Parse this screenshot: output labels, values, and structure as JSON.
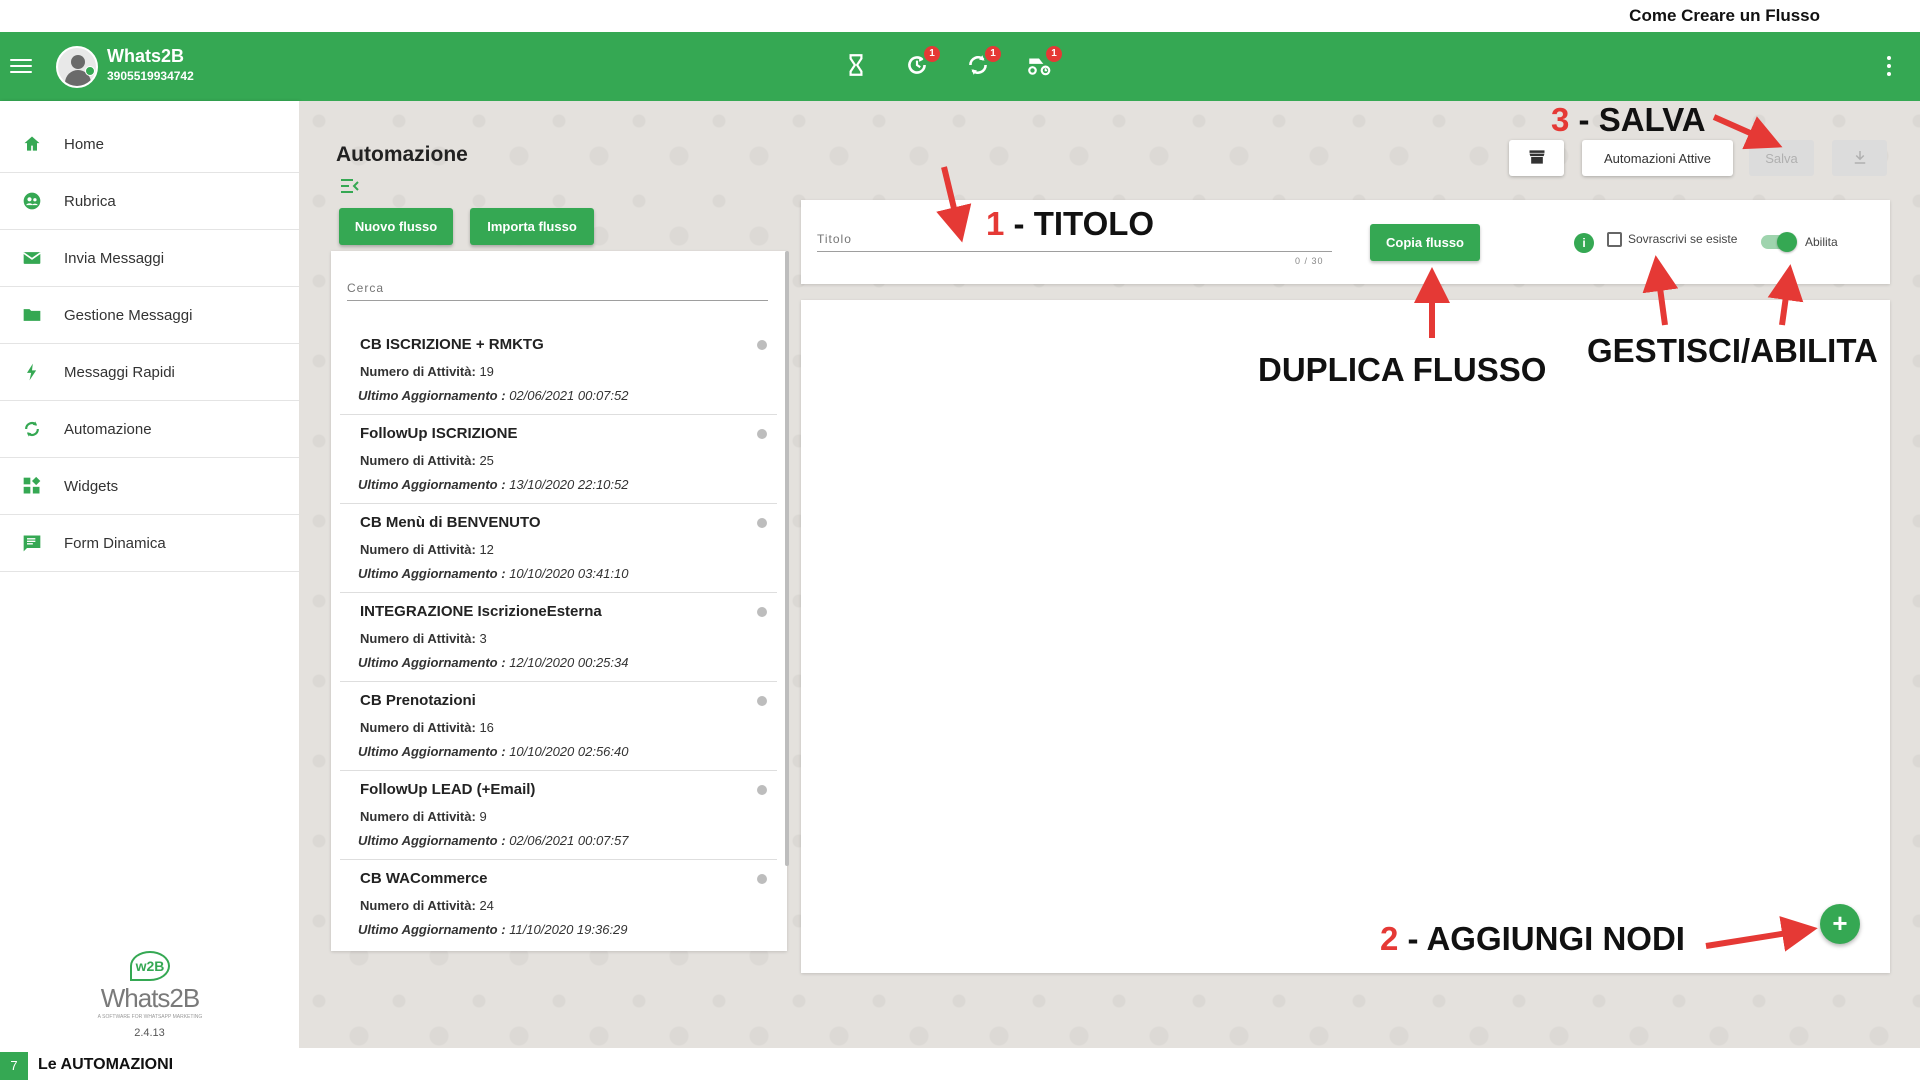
{
  "caption": {
    "top": "Come Creare un Flusso",
    "page_number": "7",
    "bottom": "Le AUTOMAZIONI"
  },
  "header": {
    "app_name": "Whats2B",
    "phone": "3905519934742",
    "badges": {
      "history": "1",
      "sync": "1",
      "moto": "1"
    },
    "icons": [
      "hourglass-icon",
      "history-icon",
      "sync-icon",
      "moto-icon",
      "kebab-menu-icon"
    ],
    "color": "#35a853"
  },
  "sidebar": {
    "items": [
      {
        "label": "Home",
        "icon": "home-icon"
      },
      {
        "label": "Rubrica",
        "icon": "contacts-icon"
      },
      {
        "label": "Invia Messaggi",
        "icon": "mail-icon"
      },
      {
        "label": "Gestione Messaggi",
        "icon": "folder-icon"
      },
      {
        "label": "Messaggi Rapidi",
        "icon": "bolt-icon"
      },
      {
        "label": "Automazione",
        "icon": "sync-icon"
      },
      {
        "label": "Widgets",
        "icon": "widgets-icon"
      },
      {
        "label": "Form Dinamica",
        "icon": "form-icon"
      }
    ],
    "logo_text": "Whats2B",
    "logo_tagline": "A SOFTWARE FOR WHATSAPP MARKETING",
    "version": "2.4.13"
  },
  "main": {
    "title": "Automazione",
    "buttons": {
      "new_flow": "Nuovo flusso",
      "import_flow": "Importa flusso",
      "active_automations": "Automazioni Attive",
      "save": "Salva",
      "copy_flow": "Copia flusso"
    },
    "search": {
      "placeholder": "Cerca"
    },
    "flows": [
      {
        "name": "CB ISCRIZIONE + RMKTG",
        "activities": "19",
        "updated": "02/06/2021 00:07:52"
      },
      {
        "name": "FollowUp ISCRIZIONE",
        "activities": "25",
        "updated": "13/10/2020 22:10:52"
      },
      {
        "name": "CB Menù di BENVENUTO",
        "activities": "12",
        "updated": "10/10/2020 03:41:10"
      },
      {
        "name": "INTEGRAZIONE IscrizioneEsterna",
        "activities": "3",
        "updated": "12/10/2020 00:25:34"
      },
      {
        "name": "CB Prenotazioni",
        "activities": "16",
        "updated": "10/10/2020 02:56:40"
      },
      {
        "name": "FollowUp LEAD (+Email)",
        "activities": "9",
        "updated": "02/06/2021 00:07:57"
      },
      {
        "name": "CB WACommerce",
        "activities": "24",
        "updated": "11/10/2020 19:36:29"
      }
    ],
    "flow_labels": {
      "activities": "Numero di Attività:",
      "updated": "Ultimo Aggiornamento :"
    },
    "editor": {
      "title_placeholder": "Titolo",
      "title_counter": "0 / 30",
      "overwrite_label": "Sovrascrivi se esiste",
      "enable_label": "Abilita",
      "enabled": true
    }
  },
  "annotations": {
    "titolo_num": "1",
    "titolo": "- TITOLO",
    "salva_num": "3",
    "salva": "- SALVA",
    "duplica": "DUPLICA FLUSSO",
    "gestisci": "GESTISCI/ABILITA",
    "nodi_num": "2",
    "nodi": "- AGGIUNGI NODI",
    "accent": "#e53935"
  }
}
